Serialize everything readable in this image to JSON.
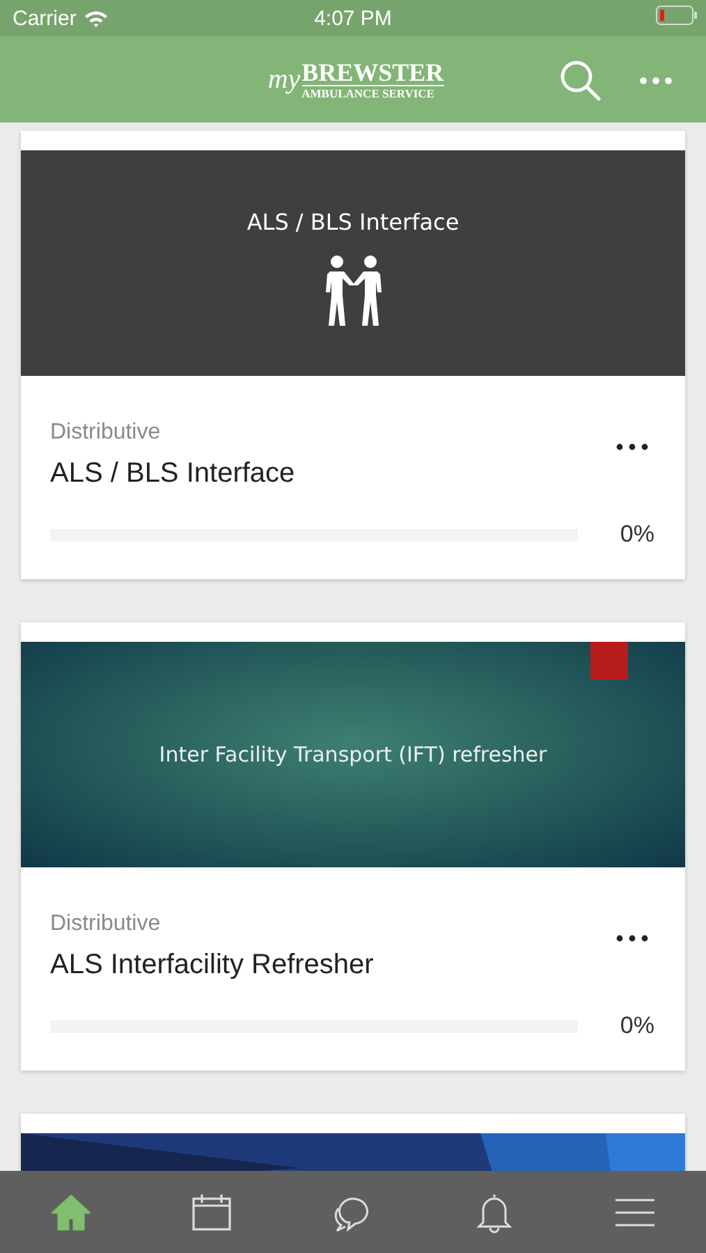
{
  "status_bar": {
    "carrier": "Carrier",
    "time": "4:07 PM"
  },
  "header": {
    "logo": {
      "script": "my",
      "name": "BREWSTER",
      "tagline": "AMBULANCE SERVICE"
    }
  },
  "courses": [
    {
      "kind": "slide-dark",
      "cover_title": "ALS / BLS Interface",
      "category": "Distributive",
      "title": "ALS / BLS Interface",
      "level": 0,
      "percent": "0%"
    },
    {
      "kind": "slide-teal",
      "cover_title": "Inter Facility Transport (IFT) refresher",
      "category": "Distributive",
      "title": "ALS Interfacility Refresher",
      "level": 0,
      "percent": "0%"
    },
    {
      "kind": "picture"
    }
  ],
  "tabs": [
    {
      "kind": "home",
      "selected": true
    },
    {
      "kind": "calendar",
      "selected": false
    },
    {
      "kind": "chat",
      "selected": false
    },
    {
      "kind": "bell",
      "selected": false
    },
    {
      "kind": "menu",
      "selected": false
    }
  ]
}
